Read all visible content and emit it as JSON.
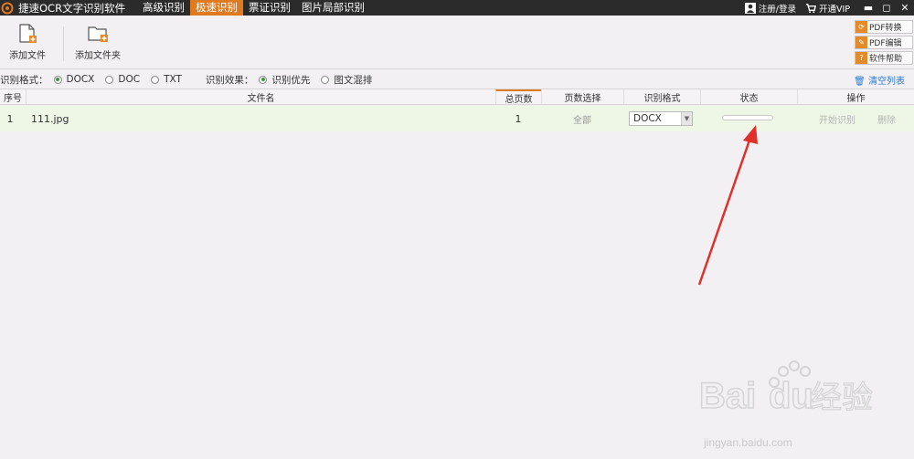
{
  "titlebar": {
    "app_title": "捷速OCR文字识别软件",
    "tabs": [
      {
        "label": "高级识别"
      },
      {
        "label": "极速识别"
      },
      {
        "label": "票证识别"
      },
      {
        "label": "图片局部识别"
      }
    ],
    "login": "注册/登录",
    "vip": "开通VIP",
    "minimize": "▬",
    "maximize": "◻",
    "close": "✕",
    "accent": "#e07a21"
  },
  "toolbar": {
    "add_file": "添加文件",
    "add_folder": "添加文件夹",
    "side_buttons": [
      {
        "label": "PDF转换",
        "icon": "refresh-icon"
      },
      {
        "label": "PDF编辑",
        "icon": "pencil-icon"
      },
      {
        "label": "软件帮助",
        "icon": "help-icon"
      }
    ]
  },
  "options": {
    "format_label": "识别格式：",
    "formats": [
      {
        "label": "DOCX",
        "selected": true
      },
      {
        "label": "DOC",
        "selected": false
      },
      {
        "label": "TXT",
        "selected": false
      }
    ],
    "effect_label": "识别效果：",
    "effects": [
      {
        "label": "识别优先",
        "selected": true
      },
      {
        "label": "图文混排",
        "selected": false
      }
    ],
    "clear_list": "清空列表"
  },
  "table": {
    "headers": {
      "index": "序号",
      "filename": "文件名",
      "total_pages": "总页数",
      "page_select": "页数选择",
      "format": "识别格式",
      "status": "状态",
      "action": "操作"
    },
    "rows": [
      {
        "index": "1",
        "filename": "111.jpg",
        "total_pages": "1",
        "page_select": "全部",
        "format": "DOCX",
        "progress": 0,
        "start": "开始识别",
        "delete": "删除"
      }
    ]
  },
  "watermark": {
    "brand": "Baidu经验",
    "url": "jingyan.baidu.com"
  }
}
